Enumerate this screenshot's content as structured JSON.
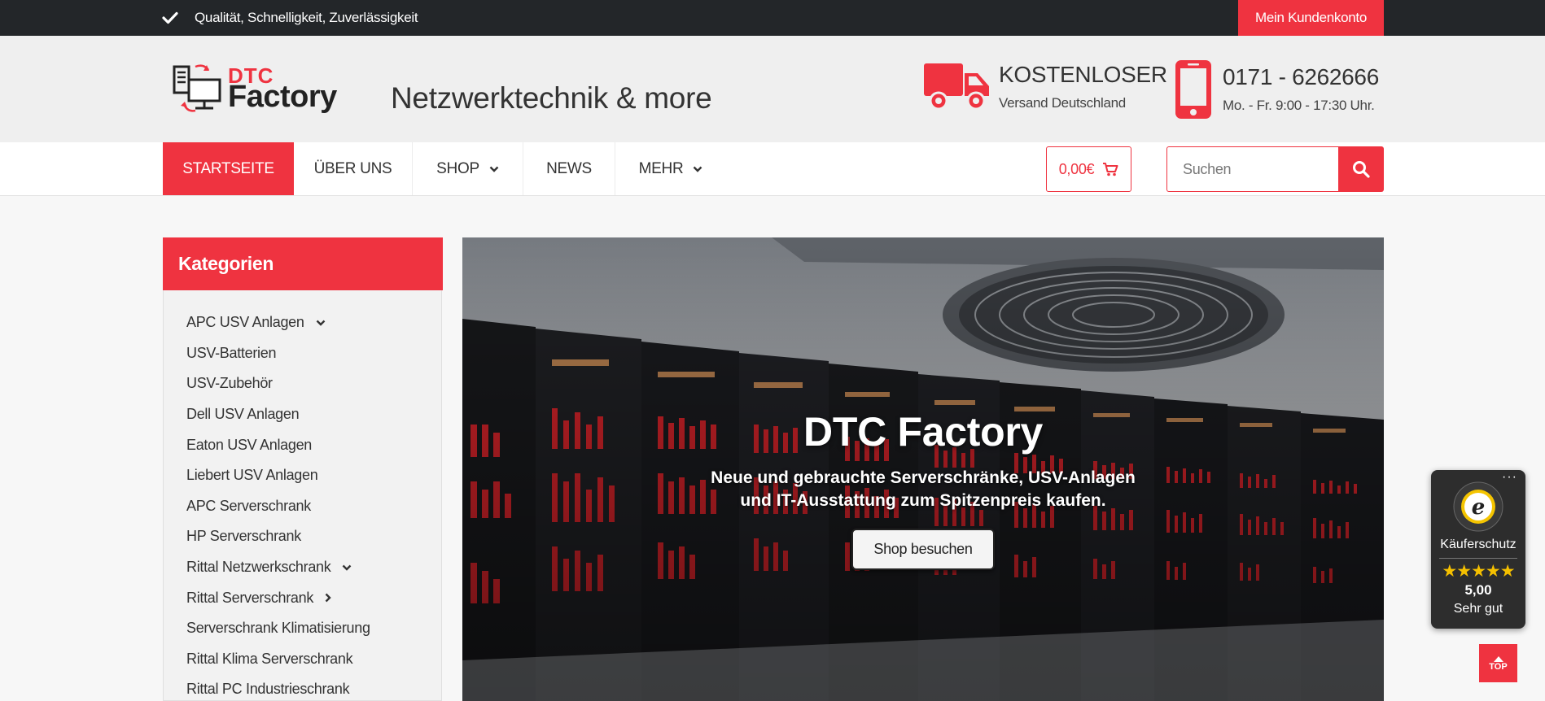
{
  "topbar": {
    "tagline": "Qualität, Schnelligkeit, Zuverlässigkeit",
    "account_label": "Mein Kundenkonto"
  },
  "header": {
    "logo_line1": "DTC",
    "logo_line2": "Factory",
    "slogan": "Netzwerktechnik & more",
    "shipping_title": "KOSTENLOSER",
    "shipping_sub": "Versand Deutschland",
    "phone_title": "0171 - 6262666",
    "phone_sub": "Mo. - Fr. 9:00 - 17:30 Uhr."
  },
  "nav": {
    "items": [
      {
        "label": "STARTSEITE",
        "active": true
      },
      {
        "label": "ÜBER UNS"
      },
      {
        "label": "SHOP",
        "dropdown": true
      },
      {
        "label": "NEWS"
      },
      {
        "label": "MEHR",
        "dropdown": true
      }
    ],
    "cart_total": "0,00€",
    "search_placeholder": "Suchen"
  },
  "sidebar": {
    "title": "Kategorien",
    "items": [
      {
        "label": "APC USV Anlagen",
        "chevron": "down"
      },
      {
        "label": "USV-Batterien"
      },
      {
        "label": "USV-Zubehör"
      },
      {
        "label": "Dell USV Anlagen"
      },
      {
        "label": "Eaton USV Anlagen"
      },
      {
        "label": "Liebert USV Anlagen"
      },
      {
        "label": "APC Serverschrank"
      },
      {
        "label": "HP Serverschrank"
      },
      {
        "label": "Rittal Netzwerkschrank",
        "chevron": "down"
      },
      {
        "label": "Rittal Serverschrank",
        "chevron": "right"
      },
      {
        "label": "Serverschrank Klimatisierung"
      },
      {
        "label": "Rittal Klima Serverschrank"
      },
      {
        "label": "Rittal PC Industrieschrank"
      }
    ]
  },
  "hero": {
    "title": "DTC Factory",
    "subtitle_line1": "Neue und gebrauchte Serverschränke, USV-Anlagen",
    "subtitle_line2": "und IT-Ausstattung zum Spitzenpreis kaufen.",
    "button_label": "Shop besuchen"
  },
  "trust_badge": {
    "dots": "···",
    "label": "Käuferschutz",
    "stars": "★★★★★",
    "score": "5,00",
    "rating_text": "Sehr gut"
  },
  "top_button": {
    "label": "TOP"
  },
  "colors": {
    "accent": "#ef3340",
    "topbar_bg": "#232629",
    "header_bg": "#efefef"
  }
}
